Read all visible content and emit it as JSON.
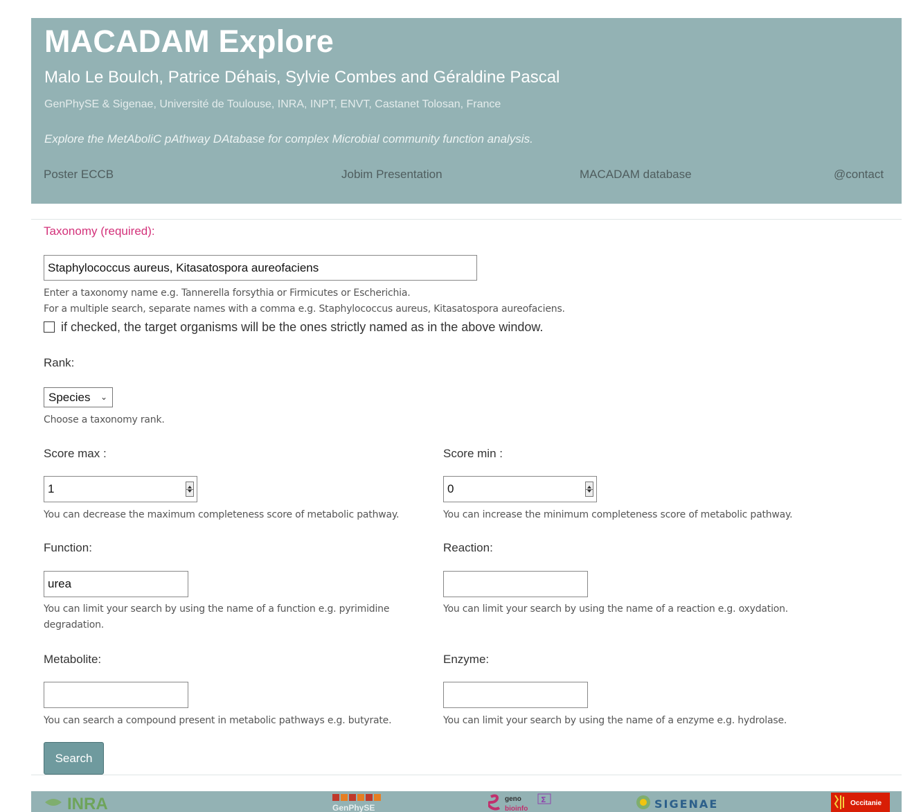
{
  "header": {
    "title": "MACADAM Explore",
    "authors": "Malo Le Boulch, Patrice Déhais, Sylvie Combes and Géraldine Pascal",
    "affiliation": "GenPhySE & Sigenae, Université de Toulouse, INRA, INPT, ENVT, Castanet Tolosan, France",
    "tagline": "Explore the MetAboliC pAthway DAtabase for complex Microbial community function analysis.",
    "nav": [
      "Poster ECCB",
      "Jobim Presentation",
      "MACADAM database",
      "@contact"
    ]
  },
  "form": {
    "taxonomy_label": "Taxonomy (required):",
    "taxonomy_value": "Staphylococcus aureus, Kitasatospora aureofaciens",
    "taxonomy_help1": "Enter a taxonomy name e.g. Tannerella forsythia or Firmicutes or Escherichia.",
    "taxonomy_help2": "For a multiple search, separate names with a comma e.g. Staphylococcus aureus, Kitasatospora aureofaciens.",
    "strict_checkbox_label": "if checked, the target organisms will be the ones strictly named as in the above window.",
    "strict_checked": false,
    "rank_label": "Rank:",
    "rank_value": "Species",
    "rank_help": "Choose a taxonomy rank.",
    "score_max_label": "Score max :",
    "score_max_value": "1",
    "score_max_help": "You can decrease the maximum completeness score of metabolic pathway.",
    "score_min_label": "Score min :",
    "score_min_value": "0",
    "score_min_help": "You can increase the minimum completeness score of metabolic pathway.",
    "function_label": "Function:",
    "function_value": "urea",
    "function_help": "You can limit your search by using the name of a function e.g. pyrimidine degradation.",
    "reaction_label": "Reaction:",
    "reaction_value": "",
    "reaction_help": "You can limit your search by using the name of a reaction e.g. oxydation.",
    "metabolite_label": "Metabolite:",
    "metabolite_value": "",
    "metabolite_help": "You can search a compound present in metabolic pathways e.g. butyrate.",
    "enzyme_label": "Enzyme:",
    "enzyme_value": "",
    "enzyme_help": "You can limit your search by using the name of a enzyme e.g. hydrolase.",
    "search_button": "Search"
  },
  "footer": {
    "logos": [
      "INRA",
      "GenPhySE",
      "genotoul bioinfo",
      "SIGENAE",
      "Occitanie"
    ]
  },
  "colors": {
    "header_bg": "#93b2b4",
    "button_bg": "#6f9a9e",
    "required_label": "#d3317a"
  }
}
